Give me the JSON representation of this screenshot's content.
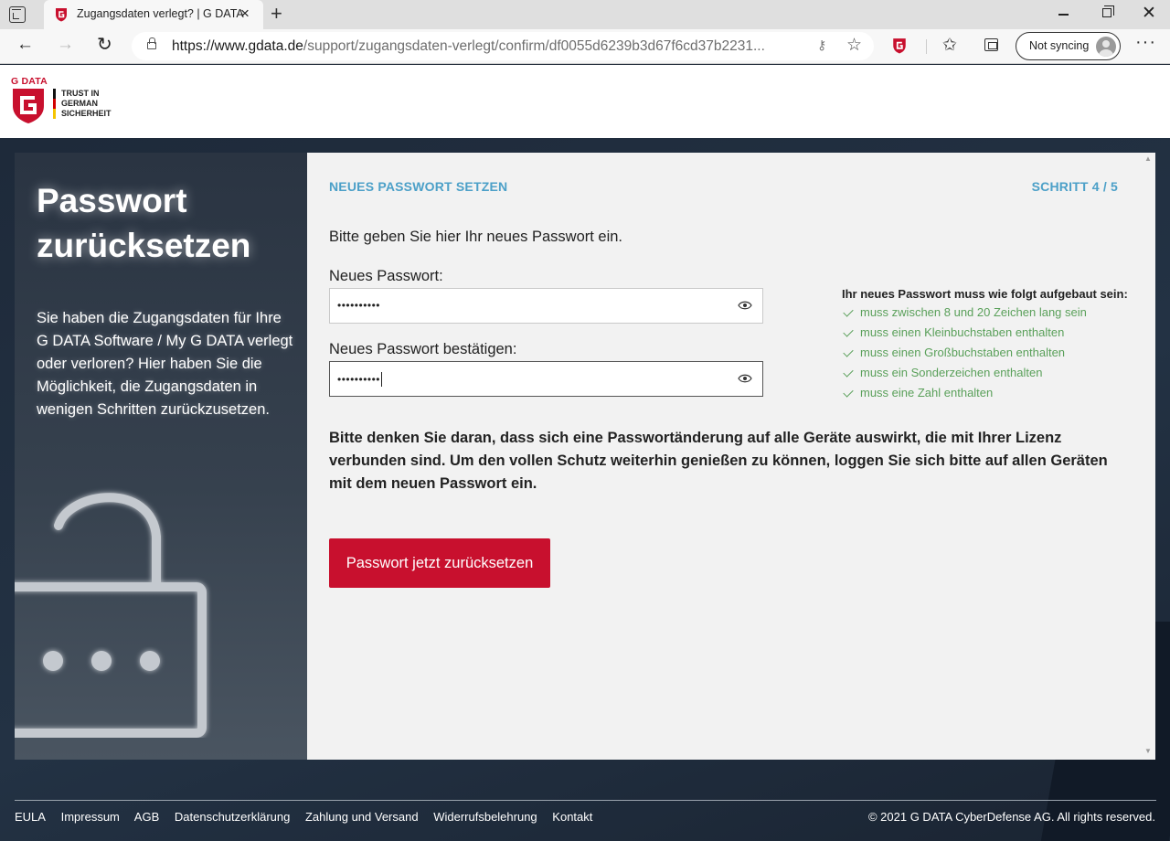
{
  "browser": {
    "tab_title": "Zugangsdaten verlegt? | G DATA",
    "url_host": "https://www.gdata.de",
    "url_path": "/support/zugangsdaten-verlegt/confirm/df0055d6239b3d67f6cd37b2231...",
    "sync_label": "Not syncing"
  },
  "header": {
    "logo_text": "G DATA",
    "tagline": [
      "TRUST IN",
      "GERMAN",
      "SICHERHEIT"
    ]
  },
  "left": {
    "title": "Passwort zurücksetzen",
    "description": "Sie haben die Zugangsdaten für Ihre G DATA Software / My G DATA verlegt oder verloren? Hier haben Sie die Möglichkeit, die Zugangsdaten in wenigen Schritten zurückzusetzen."
  },
  "form": {
    "step_title": "NEUES PASSWORT SETZEN",
    "step_counter": "SCHRITT 4 / 5",
    "instruction": "Bitte geben Sie hier Ihr neues Passwort ein.",
    "new_password_label": "Neues Passwort:",
    "new_password_value": "••••••••••",
    "confirm_password_label": "Neues Passwort bestätigen:",
    "confirm_password_value": "••••••••••",
    "requirements_title": "Ihr neues Passwort muss wie folgt aufgebaut sein:",
    "requirements": [
      "muss zwischen 8 und 20 Zeichen lang sein",
      "muss einen Kleinbuchstaben enthalten",
      "muss einen Großbuchstaben enthalten",
      "muss ein Sonderzeichen enthalten",
      "muss eine Zahl enthalten"
    ],
    "notice": "Bitte denken Sie daran, dass sich eine Passwortänderung auf alle Geräte auswirkt, die mit Ihrer Lizenz verbunden sind. Um den vollen Schutz weiterhin genießen zu können, loggen Sie sich bitte auf allen Geräten mit dem neuen Passwort ein.",
    "submit_label": "Passwort jetzt zurücksetzen"
  },
  "footer": {
    "links": [
      "EULA",
      "Impressum",
      "AGB",
      "Datenschutzerklärung",
      "Zahlung und Versand",
      "Widerrufsbelehrung",
      "Kontakt"
    ],
    "copyright": "© 2021 G DATA CyberDefense AG. All rights reserved."
  },
  "colors": {
    "brand_red": "#c8102e",
    "accent_blue": "#4ca0c8",
    "success_green": "#5aa05a"
  }
}
